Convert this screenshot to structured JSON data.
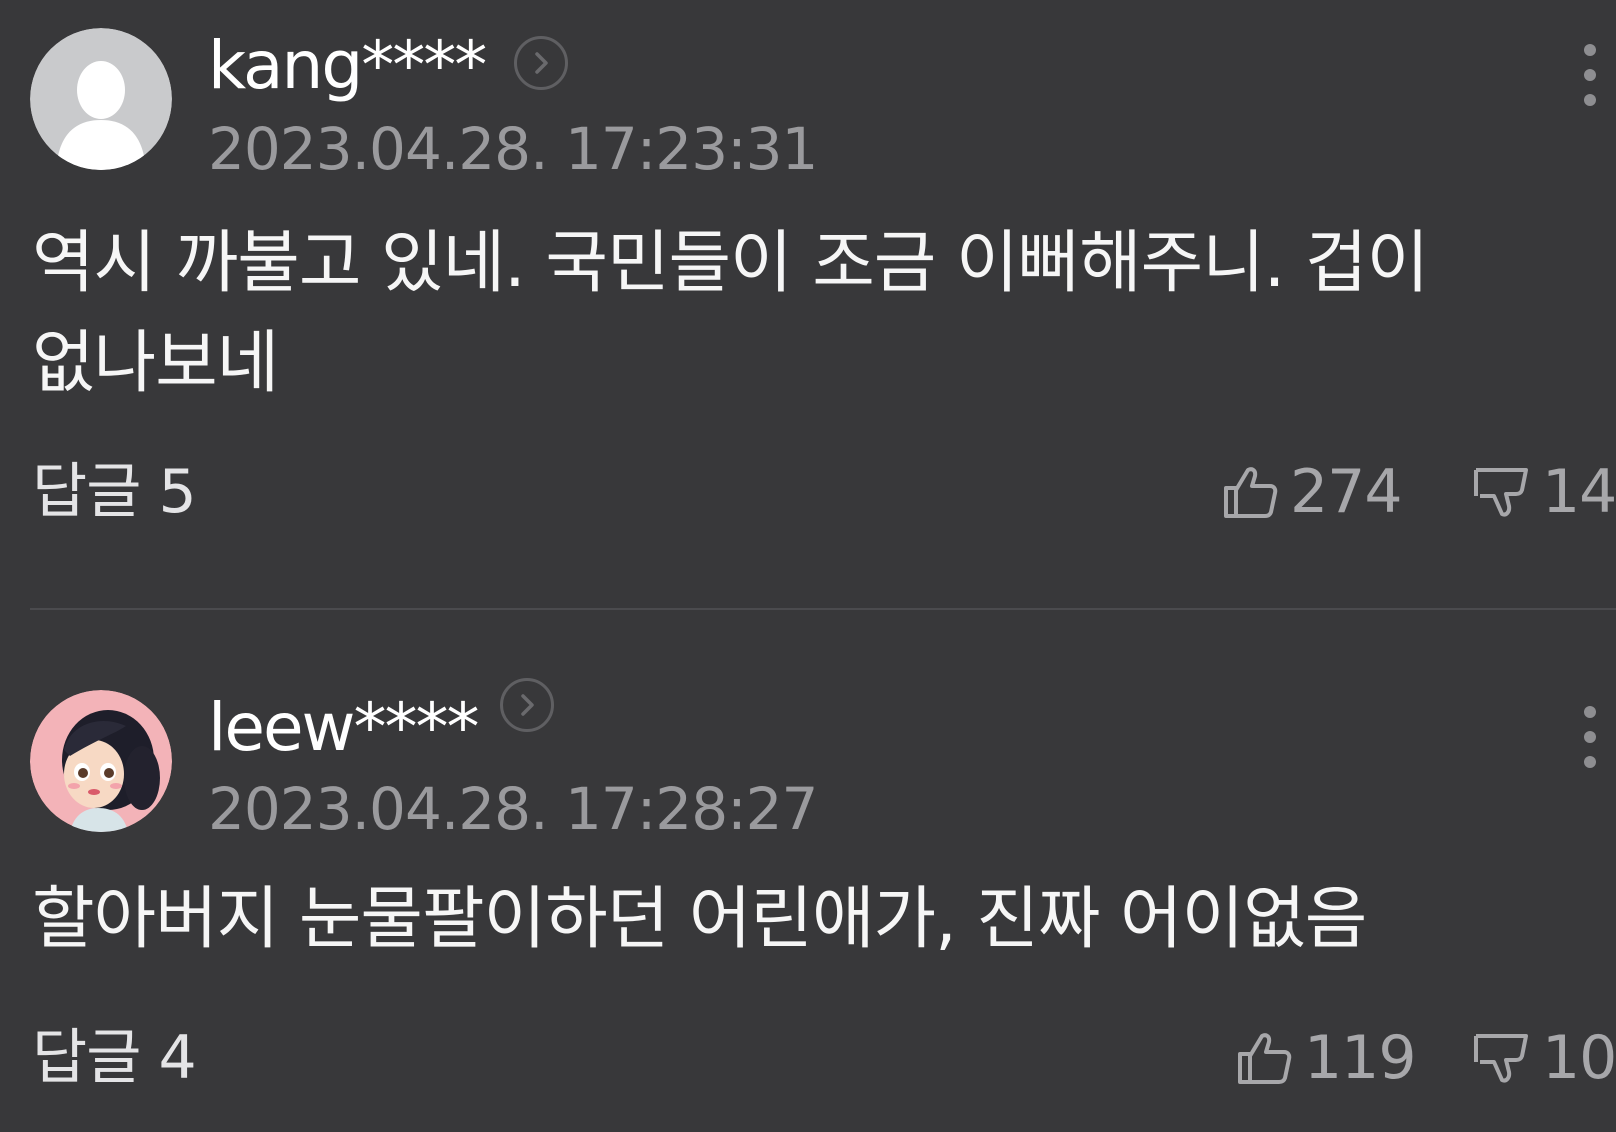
{
  "colors": {
    "background": "#38383a",
    "text_primary": "#ffffff",
    "text_secondary": "#9a9a9d",
    "divider": "#4b4b4e"
  },
  "comments": [
    {
      "author": "kang****",
      "avatar": "default-user-icon",
      "timestamp": "2023.04.28. 17:23:31",
      "text": "역시 까불고 있네. 국민들이 조금 이뻐해주니. 겁이 없나보네",
      "reply_label": "답글 5",
      "likes": "274",
      "dislikes": "14"
    },
    {
      "author": "leew****",
      "avatar": "character-avatar-icon",
      "timestamp": "2023.04.28. 17:28:27",
      "text": "할아버지 눈물팔이하던 어린애가, 진짜 어이없음",
      "reply_label": "답글 4",
      "likes": "119",
      "dislikes": "10"
    }
  ]
}
